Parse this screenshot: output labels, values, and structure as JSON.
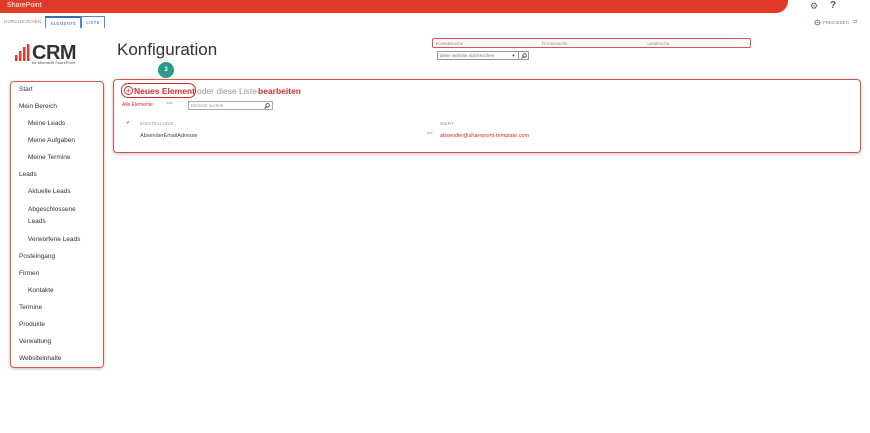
{
  "suite": {
    "brand": "SharePoint"
  },
  "ribbon": {
    "tabs": [
      "DURCHSUCHEN",
      "ELEMENTE",
      "LISTE"
    ],
    "share_label": "FREIGEBEN"
  },
  "logo": {
    "text": "CRM",
    "subtitle": "for Microsoft SharePoint"
  },
  "page": {
    "title": "Konfiguration"
  },
  "search": {
    "tabs": [
      "Kontaktsuche",
      "Firmensuche",
      "Leadsuche"
    ],
    "site_placeholder": "diese website durchsuchen"
  },
  "nav": {
    "items": [
      {
        "label": "Start",
        "level": 0
      },
      {
        "label": "Mein Bereich",
        "level": 0
      },
      {
        "label": "Meine Leads",
        "level": 1
      },
      {
        "label": "Meine Aufgaben",
        "level": 1
      },
      {
        "label": "Meine Termine",
        "level": 1
      },
      {
        "label": "Leads",
        "level": 0
      },
      {
        "label": "Aktuelle Leads",
        "level": 1
      },
      {
        "label": "Abgeschlossene",
        "level": 1
      },
      {
        "label": "Leads",
        "level": 1
      },
      {
        "label": "Verworfene Leads",
        "level": 1
      },
      {
        "label": "Posteingang",
        "level": 0
      },
      {
        "label": "Firmen",
        "level": 0
      },
      {
        "label": "Kontakte",
        "level": 1
      },
      {
        "label": "Termine",
        "level": 0
      },
      {
        "label": "Produkte",
        "level": 0
      },
      {
        "label": "Verwaltung",
        "level": 0
      },
      {
        "label": "Websiteinhalte",
        "level": 0
      }
    ]
  },
  "list": {
    "new_item_label": "Neues Element",
    "or_text": "oder diese Liste",
    "edit_label": "bearbeiten",
    "step_badge": "3",
    "view_label": "Alle Elemente",
    "more_label": "···",
    "search_placeholder": "Element suchen",
    "columns": [
      "EINSTELLUNG",
      "WERT"
    ],
    "rows": [
      {
        "setting": "AbsenderEmailAdresse",
        "value": "absender@sharepoint-template.com"
      }
    ]
  },
  "colors": {
    "accent": "#e23a2a",
    "link": "#c9302c",
    "badge": "#2b9a8c"
  }
}
